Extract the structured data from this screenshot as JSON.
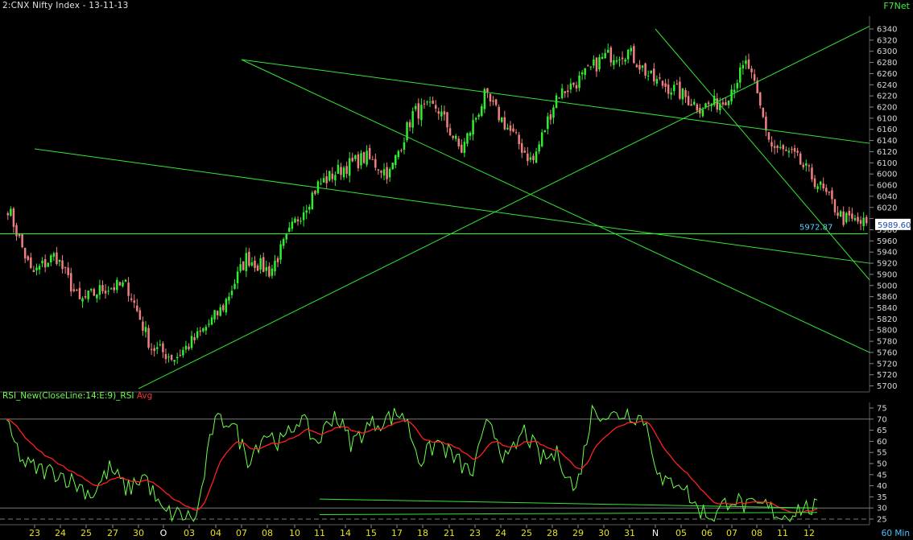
{
  "header": {
    "title": "2:CNX Nifty Index - 13-11-13",
    "brand": "F7Net"
  },
  "rsi_panel": {
    "label_main": "RSI_New(CloseLine:14:E:9)_RSI",
    "label_avg": "Avg"
  },
  "footer": {
    "interval": "60 Min"
  },
  "colors": {
    "up": "#31ee31",
    "down": "#f08080",
    "trendline": "#34e634",
    "rsi": "#6cff4c",
    "rsi_avg": "#ff2020",
    "axis_text": "#d8d8d8",
    "date_text": "#e8e020",
    "value_box_bg": "#ffffff",
    "value_box_text": "#1a4ab0",
    "annotation_text": "#5ad0ff"
  },
  "price_axis": {
    "ticks": [
      6340,
      6320,
      6300,
      6280,
      6260,
      6240,
      6220,
      6200,
      6180,
      6160,
      6140,
      6120,
      6100,
      6080,
      6060,
      6040,
      6020,
      6000,
      5980,
      5960,
      5940,
      5920,
      5900,
      5880,
      5860,
      5840,
      5820,
      5800,
      5780,
      5760,
      5740,
      5720,
      5700
    ],
    "tick_labels": [
      "6340",
      "6320",
      "6300",
      "6280",
      "6260",
      "6240",
      "6220",
      "6200",
      "6100",
      "6160",
      "6140",
      "6120",
      "6100",
      "6000",
      "6060",
      "6040",
      "6020",
      "",
      "5980",
      "5960",
      "5940",
      "5920",
      "5900",
      "5000",
      "5860",
      "5840",
      "5820",
      "5800",
      "5780",
      "5760",
      "5720",
      "5720",
      "5700"
    ]
  },
  "current_value_label": "5989.60",
  "line_value_label": "5972.87",
  "rsi_axis": {
    "ticks": [
      75,
      70,
      65,
      60,
      55,
      50,
      45,
      40,
      35,
      30,
      25
    ],
    "levels": [
      70,
      30,
      25
    ]
  },
  "date_axis": {
    "labels": [
      "23",
      "24",
      "25",
      "27",
      "30",
      "O",
      "03",
      "04",
      "07",
      "08",
      "10",
      "11",
      "14",
      "15",
      "17",
      "18",
      "21",
      "23",
      "24",
      "25",
      "28",
      "29",
      "30",
      "31",
      "N",
      "05",
      "06",
      "07",
      "08",
      "11",
      "12",
      "13"
    ],
    "marker_labels": [
      "O",
      "N"
    ]
  },
  "chart_data": {
    "type": "candlestick",
    "title": "2:CNX Nifty Index - 13-11-13",
    "interval": "60 Min",
    "y_range": [
      5695,
      6360
    ],
    "horizontal_line": 5972.87,
    "last_close": 5989.6,
    "x_labels": [
      "23",
      "24",
      "25",
      "27",
      "30",
      "O",
      "03",
      "04",
      "07",
      "08",
      "10",
      "11",
      "14",
      "15",
      "17",
      "18",
      "21",
      "23",
      "24",
      "25",
      "28",
      "29",
      "30",
      "31",
      "N",
      "05",
      "06",
      "07",
      "08",
      "11",
      "12",
      "13"
    ],
    "anchor_closes": [
      6020,
      5900,
      5935,
      5850,
      5875,
      5880,
      5770,
      5750,
      5790,
      5840,
      5930,
      5905,
      5990,
      6060,
      6090,
      6110,
      6080,
      6190,
      6200,
      6120,
      6220,
      6160,
      6100,
      6220,
      6250,
      6290,
      6300,
      6250,
      6230,
      6200,
      6210,
      6280,
      6130,
      6110,
      6060,
      6000,
      5990
    ],
    "trendlines": [
      {
        "from": {
          "x": "30",
          "y": 5695
        },
        "to": {
          "x": "13",
          "y": 6345
        }
      },
      {
        "from": {
          "x": "N",
          "y": 6340
        },
        "to": {
          "x": "13",
          "y": 5890
        }
      },
      {
        "from": {
          "x": "07",
          "y": 6285
        },
        "to": {
          "x": "13",
          "y": 6135
        }
      },
      {
        "from": {
          "x": "07",
          "y": 6285
        },
        "to": {
          "x": "13",
          "y": 5760
        }
      },
      {
        "from": {
          "x": "23",
          "y": 6125
        },
        "to": {
          "x": "13",
          "y": 5920
        }
      }
    ],
    "indicator": {
      "name": "RSI_New(CloseLine:14:E:9)_RSI",
      "avg_name": "Avg",
      "y_range": [
        25,
        75
      ],
      "levels": [
        70,
        30,
        25
      ],
      "rsi_anchors": [
        67,
        50,
        47,
        46,
        41,
        36,
        48,
        38,
        45,
        28,
        27,
        25,
        68,
        70,
        52,
        64,
        59,
        71,
        59,
        73,
        59,
        67,
        70,
        73,
        51,
        60,
        52,
        45,
        71,
        50,
        65,
        52,
        54,
        37,
        75,
        71,
        73,
        70,
        40,
        43,
        30,
        26,
        35,
        30,
        31,
        26,
        30,
        30
      ],
      "rsi_trendlines": [
        {
          "from": {
            "x": "11",
            "y": 34
          },
          "to": {
            "x": "13",
            "y": 30
          }
        },
        {
          "from": {
            "x": "11",
            "y": 27
          },
          "to": {
            "x": "13",
            "y": 28
          }
        }
      ]
    }
  }
}
